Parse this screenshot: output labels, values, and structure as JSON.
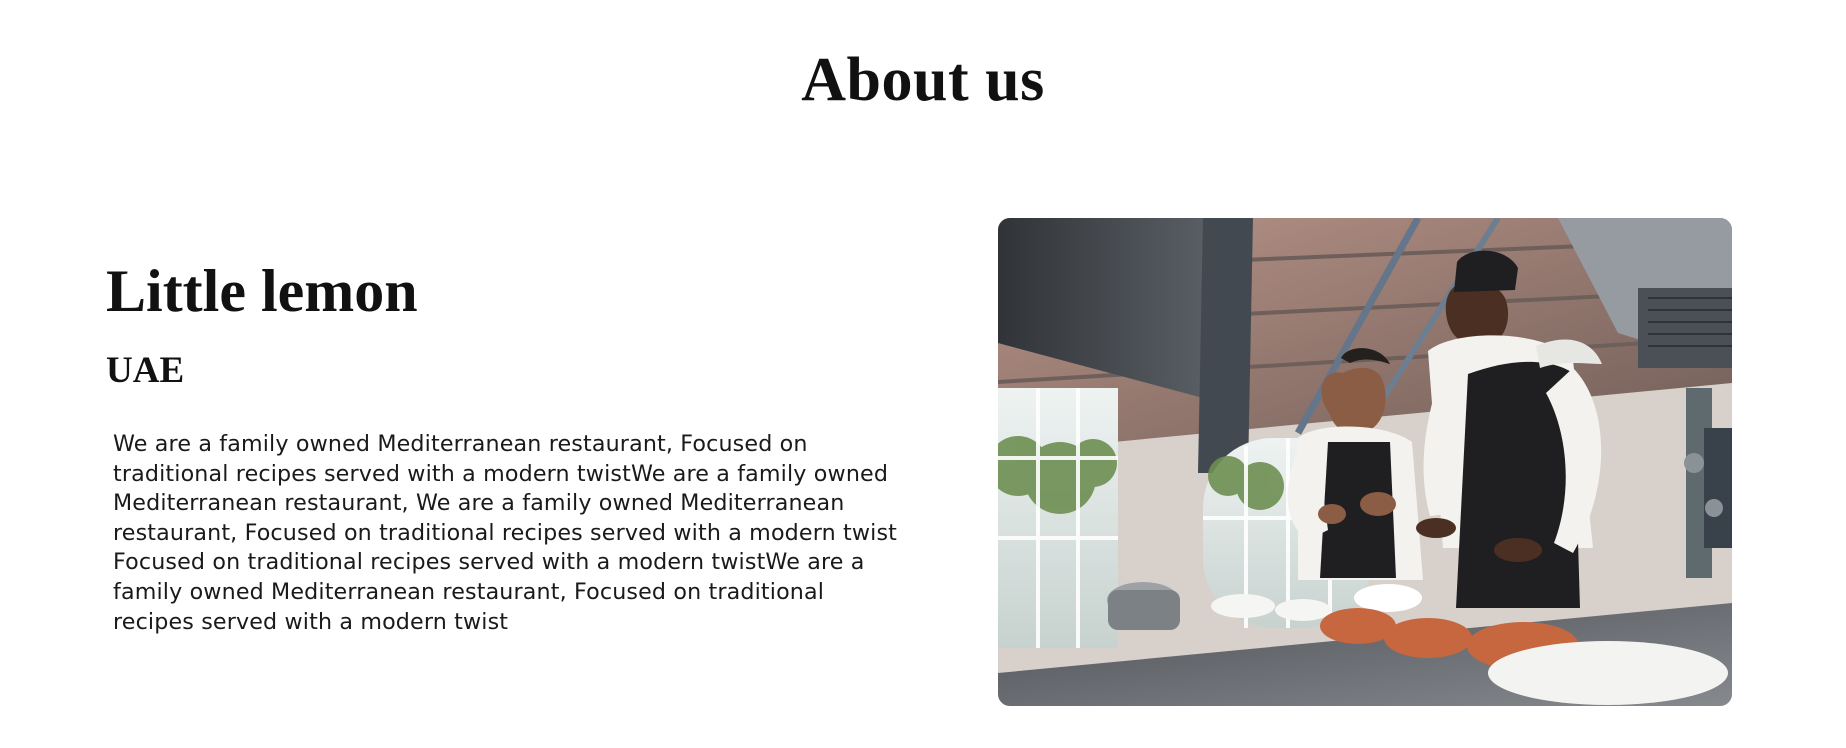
{
  "section": {
    "title": "About us"
  },
  "brand": {
    "name": "Little lemon",
    "location": "UAE",
    "description": "We are a family owned Mediterranean restaurant, Focused on traditional recipes served with a modern twistWe are a family owned Mediterranean restaurant, We are a family owned Mediterranean restaurant, Focused on traditional recipes served with a modern twist Focused on traditional recipes served with a modern twistWe are a family owned Mediterranean restaurant, Focused on traditional recipes served with a modern twist"
  },
  "image": {
    "subject": "two chefs in aprons talking in a restaurant kitchen",
    "colors": {
      "ceiling": "#8c7a72",
      "metal": "#6f7378",
      "window": "#dfe7e4",
      "greenery": "#6e8f52",
      "counter": "#5e6166",
      "bowl": "#c7673f",
      "apron": "#1f1f22",
      "shirt": "#f3f2ef"
    }
  }
}
